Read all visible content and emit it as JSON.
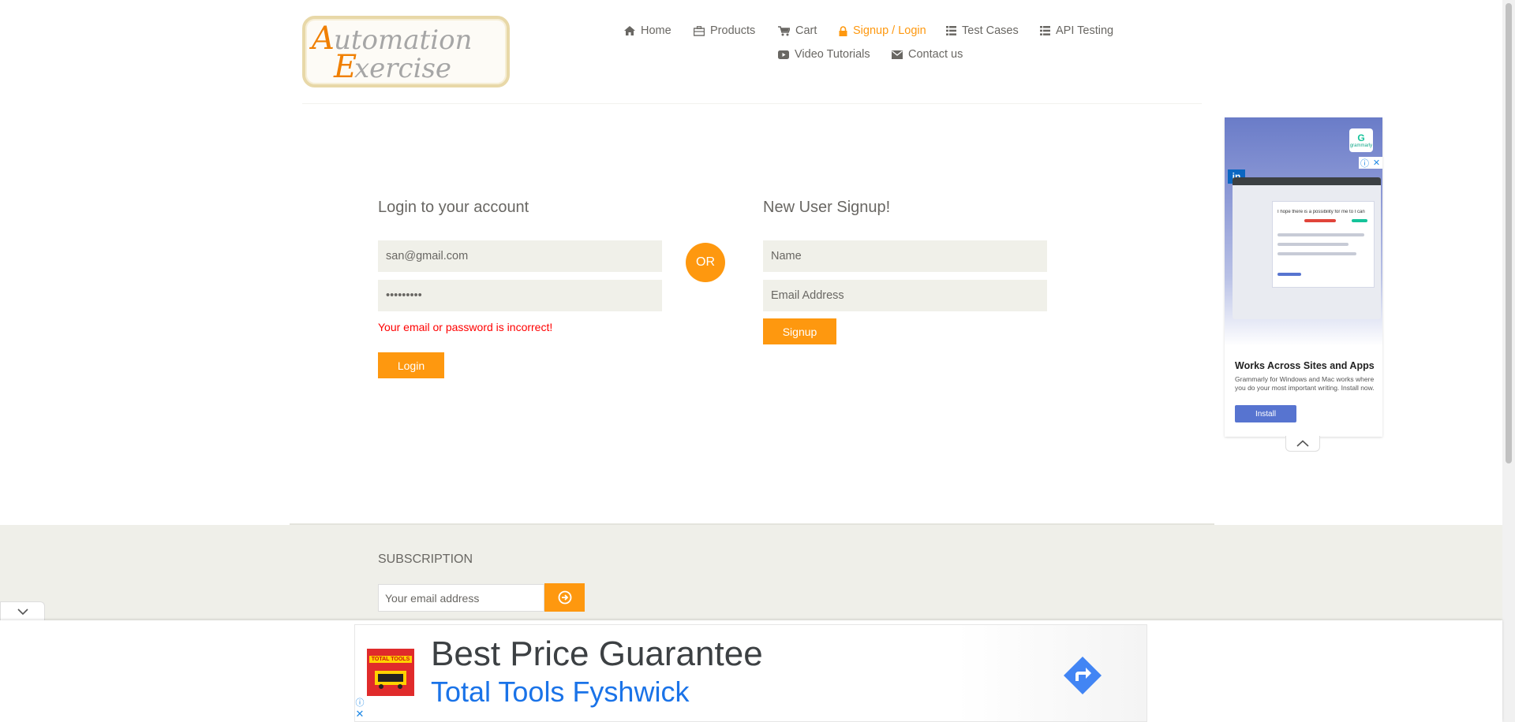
{
  "logo": {
    "word1": "Automation",
    "word2": "Exercise"
  },
  "nav": {
    "items": [
      {
        "label": "Home",
        "icon": "home-icon"
      },
      {
        "label": "Products",
        "icon": "briefcase-icon"
      },
      {
        "label": "Cart",
        "icon": "cart-icon"
      },
      {
        "label": "Signup / Login",
        "icon": "lock-icon",
        "active": true
      },
      {
        "label": "Test Cases",
        "icon": "list-icon"
      },
      {
        "label": "API Testing",
        "icon": "list-icon"
      },
      {
        "label": "Video Tutorials",
        "icon": "youtube-play-icon"
      },
      {
        "label": "Contact us",
        "icon": "envelope-icon"
      }
    ]
  },
  "login": {
    "title": "Login to your account",
    "email_value": "san@gmail.com",
    "password_value": "•••••••••",
    "error": "Your email or password is incorrect!",
    "button": "Login"
  },
  "or_label": "OR",
  "signup": {
    "title": "New User Signup!",
    "name_placeholder": "Name",
    "email_placeholder": "Email Address",
    "button": "Signup"
  },
  "side_ad": {
    "brand": "grammarly",
    "headline": "Works Across Sites and Apps",
    "description": "Grammarly for Windows and Mac works where you do your most important writing. Install now.",
    "cta": "Install",
    "mock_text": "I hope there is a possibility for me to I can"
  },
  "subscription": {
    "title": "SUBSCRIPTION",
    "placeholder": "Your email address"
  },
  "anchor_ad": {
    "headline": "Best Price Guarantee",
    "advertiser": "Total Tools Fyshwick",
    "thumb_text": "TOTAL TOOLS"
  },
  "colors": {
    "accent": "#fe980f",
    "text": "#696763",
    "field_bg": "#f0f0e9",
    "error": "#ff0000"
  }
}
